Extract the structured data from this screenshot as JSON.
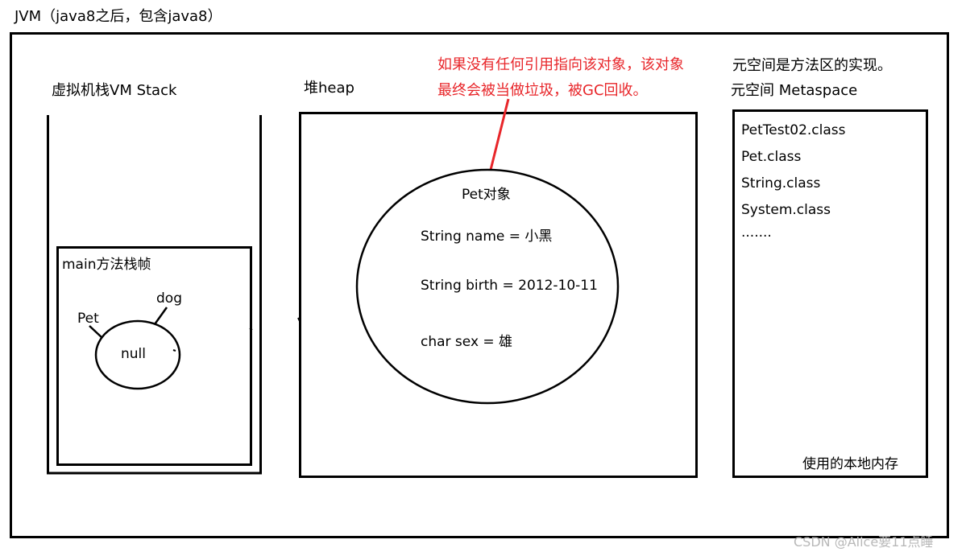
{
  "title": "JVM（java8之后，包含java8）",
  "vm_stack": {
    "label": "虚拟机栈VM Stack",
    "frame": {
      "label": "main方法栈帧",
      "variable": {
        "type_label": "Pet",
        "name_label": "dog",
        "value": "null"
      }
    }
  },
  "heap": {
    "label": "堆heap",
    "gc_note": {
      "line1": "如果没有任何引用指向该对象，该对象",
      "line2": "最终会被当做垃圾，被GC回收。",
      "color": "#e8262a"
    },
    "object": {
      "label": "Pet对象",
      "fields": [
        {
          "text": "String name = 小黑"
        },
        {
          "text": "String birth =  2012-10-11"
        },
        {
          "text": "char sex =  雄"
        }
      ]
    }
  },
  "metaspace": {
    "note": "元空间是方法区的实现。",
    "label": "元空间 Metaspace",
    "classes": [
      "PetTest02.class",
      "Pet.class",
      "String.class",
      "System.class",
      "·······"
    ],
    "footer": "使用的本地内存"
  },
  "watermark": "CSDN @Alice要11点睡"
}
